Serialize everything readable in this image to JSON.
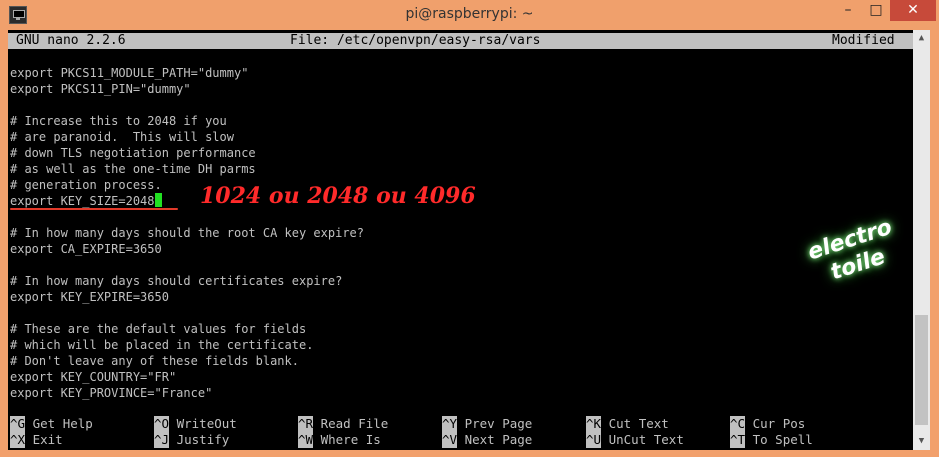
{
  "window": {
    "title": "pi@raspberrypi: ~",
    "minimize_label": "–",
    "maximize_label": "□",
    "close_label": "✕"
  },
  "nano": {
    "version": "GNU nano 2.2.6",
    "file": "File: /etc/openvpn/easy-rsa/vars",
    "status": "Modified"
  },
  "editor": {
    "lines": [
      "export PKCS11_MODULE_PATH=\"dummy\"",
      "export PKCS11_PIN=\"dummy\"",
      "",
      "# Increase this to 2048 if you",
      "# are paranoid.  This will slow",
      "# down TLS negotiation performance",
      "# as well as the one-time DH parms",
      "# generation process.",
      "export KEY_SIZE=2048",
      "",
      "# In how many days should the root CA key expire?",
      "export CA_EXPIRE=3650",
      "",
      "# In how many days should certificates expire?",
      "export KEY_EXPIRE=3650",
      "",
      "# These are the default values for fields",
      "# which will be placed in the certificate.",
      "# Don't leave any of these fields blank.",
      "export KEY_COUNTRY=\"FR\"",
      "export KEY_PROVINCE=\"France\""
    ]
  },
  "annotation": "1024 ou 2048 ou 4096",
  "watermark": {
    "line1": "electro",
    "line2": "toile"
  },
  "shortcuts": [
    {
      "key": "^G",
      "label": "Get Help"
    },
    {
      "key": "^O",
      "label": "WriteOut"
    },
    {
      "key": "^R",
      "label": "Read File"
    },
    {
      "key": "^Y",
      "label": "Prev Page"
    },
    {
      "key": "^K",
      "label": "Cut Text"
    },
    {
      "key": "^C",
      "label": "Cur Pos"
    },
    {
      "key": "^X",
      "label": "Exit"
    },
    {
      "key": "^J",
      "label": "Justify"
    },
    {
      "key": "^W",
      "label": "Where Is"
    },
    {
      "key": "^V",
      "label": "Next Page"
    },
    {
      "key": "^U",
      "label": "UnCut Text"
    },
    {
      "key": "^T",
      "label": "To Spell"
    }
  ],
  "colors": {
    "titlebar": "#f0a06c",
    "terminal_bg": "#000000",
    "terminal_fg": "#c0c0c0",
    "cursor": "#22e022",
    "annotation": "#ff2a2a"
  },
  "icons": [
    "putty-terminal-icon",
    "minimize-icon",
    "maximize-icon",
    "close-icon"
  ]
}
